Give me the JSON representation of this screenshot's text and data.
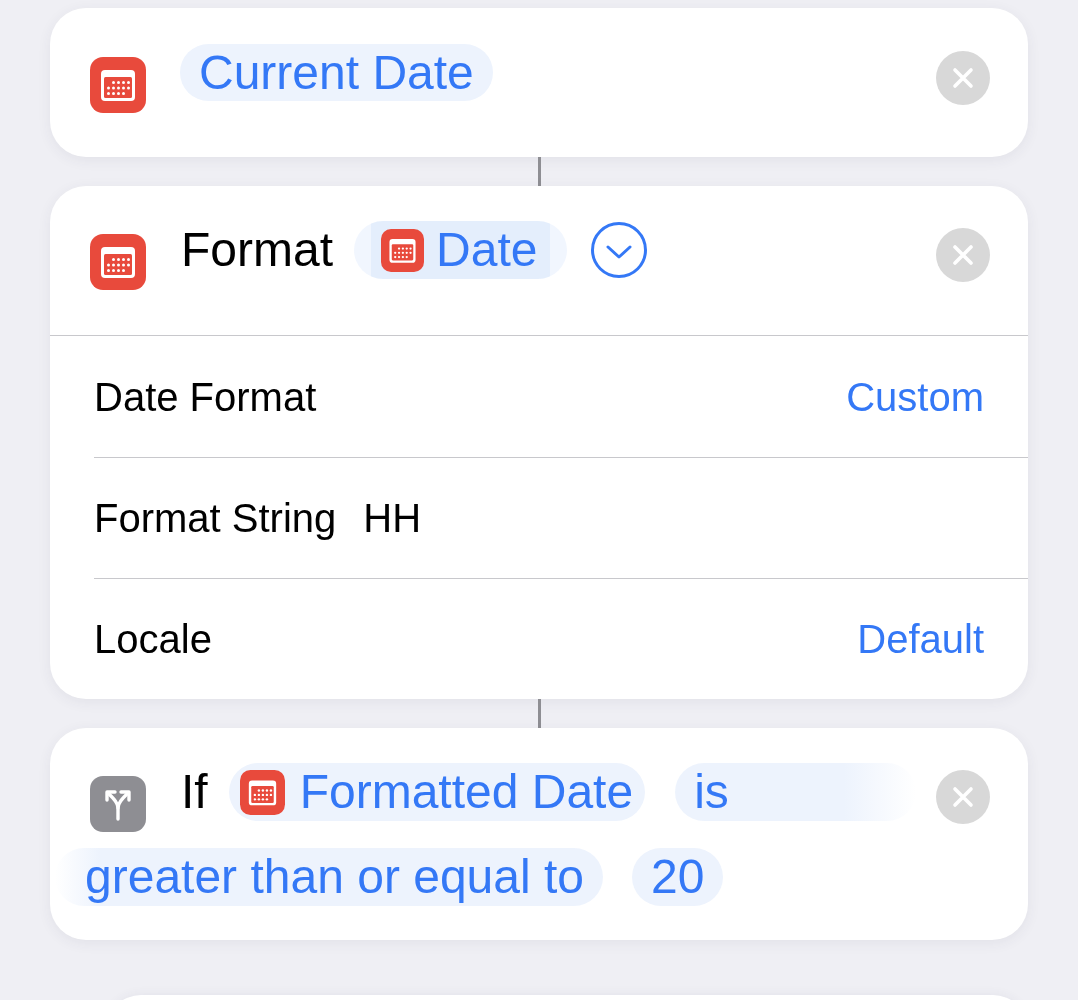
{
  "actions": [
    {
      "kind": "date",
      "parameter": "Current Date"
    },
    {
      "kind": "format",
      "title": "Format",
      "input": "Date",
      "expanded": true,
      "rows": [
        {
          "kind": "picker",
          "label": "Date Format",
          "value": "Custom"
        },
        {
          "kind": "text",
          "label": "Format String",
          "value": "HH"
        },
        {
          "kind": "picker",
          "label": "Locale",
          "value": "Default"
        }
      ]
    },
    {
      "kind": "if",
      "title": "If",
      "input": "Formatted Date",
      "condition": [
        "is",
        "greater than or equal to"
      ],
      "value": "20"
    }
  ]
}
